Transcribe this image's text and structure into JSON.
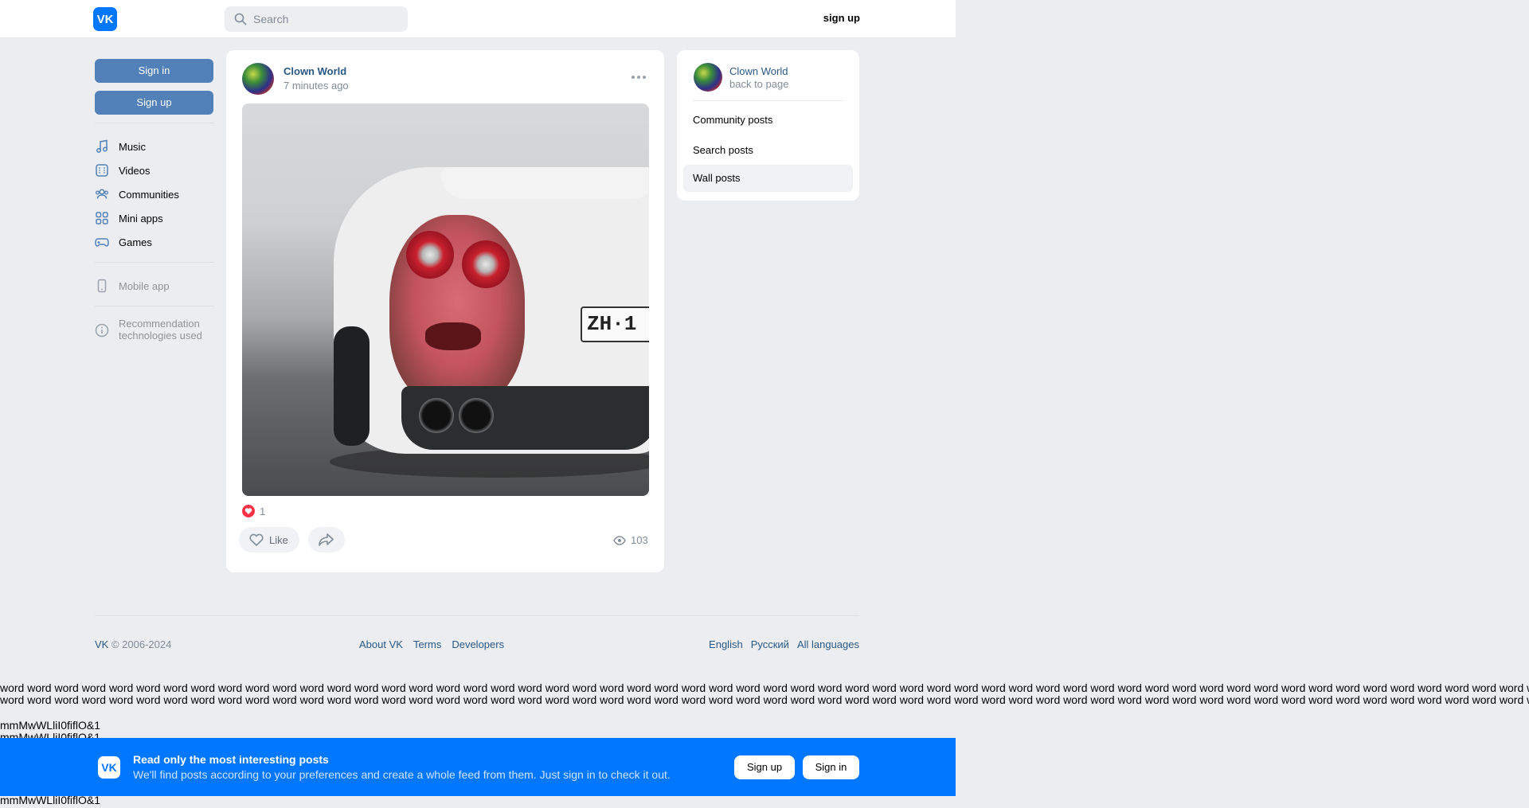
{
  "header": {
    "logo": "VK",
    "search_placeholder": "Search",
    "signup": "sign up"
  },
  "left": {
    "signin": "Sign in",
    "signup": "Sign up",
    "nav": [
      {
        "label": "Music",
        "icon": "music-icon"
      },
      {
        "label": "Videos",
        "icon": "video-icon"
      },
      {
        "label": "Communities",
        "icon": "communities-icon"
      },
      {
        "label": "Mini apps",
        "icon": "mini-apps-icon"
      },
      {
        "label": "Games",
        "icon": "gamepad-icon"
      }
    ],
    "mobile_app": "Mobile app",
    "recommendation": "Recommendation technologies used"
  },
  "post": {
    "author": "Clown World",
    "time": "7 minutes ago",
    "plate": "ZH·1",
    "likes": "1",
    "like_label": "Like",
    "views": "103"
  },
  "right": {
    "name": "Clown World",
    "back": "back to page",
    "items": [
      "Community posts",
      "Search posts",
      "Wall posts"
    ],
    "active": "Wall posts"
  },
  "footer": {
    "vk": "VK",
    "copyright": " © 2006-2024",
    "links": [
      "About VK",
      "Terms",
      "Developers"
    ],
    "langs": [
      "English",
      "Русский",
      "All languages"
    ]
  },
  "filler": {
    "word": "word",
    "probe": "mmMwWLliI0fiflO&1"
  },
  "banner": {
    "logo": "VK",
    "title": "Read only the most interesting posts",
    "subtitle": "We'll find posts according to your preferences and create a whole feed from them. Just sign in to check it out.",
    "signup": "Sign up",
    "signin": "Sign in"
  },
  "colors": {
    "brand": "#0077ff",
    "button": "#5181b8",
    "link": "#2a5885",
    "background": "#ebedf0"
  }
}
